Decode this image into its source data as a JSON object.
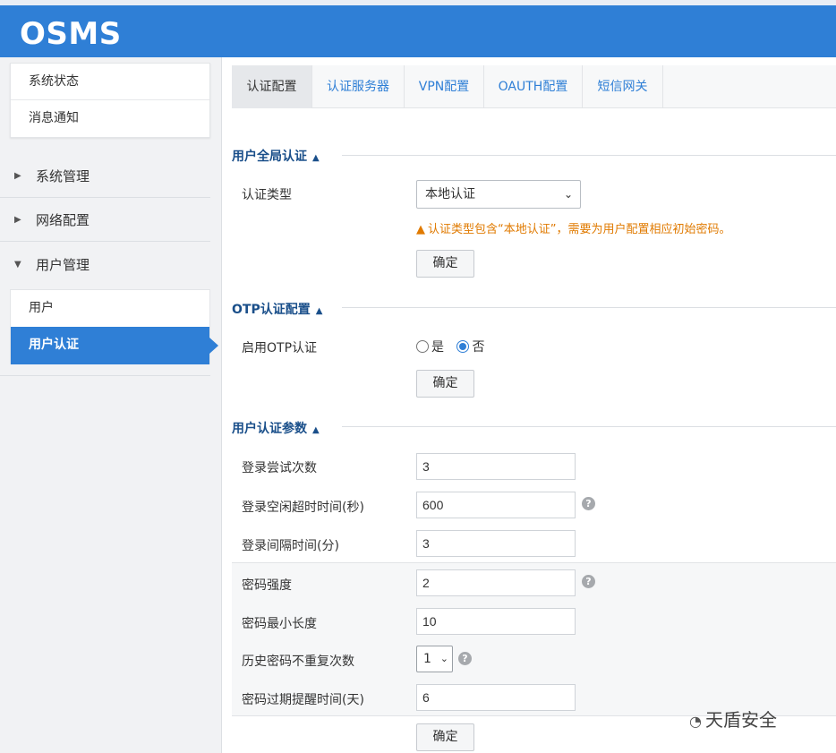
{
  "app": {
    "logo": "OSMS"
  },
  "sidebar": {
    "top_items": [
      "系统状态",
      "消息通知"
    ],
    "sections": [
      {
        "label": "系统管理",
        "state": "collapsed"
      },
      {
        "label": "网络配置",
        "state": "collapsed"
      },
      {
        "label": "用户管理",
        "state": "expanded"
      }
    ],
    "sub_items": [
      "用户",
      "用户认证"
    ],
    "active_sub": "用户认证"
  },
  "tabs": [
    "认证配置",
    "认证服务器",
    "VPN配置",
    "OAUTH配置",
    "短信网关"
  ],
  "active_tab": "认证配置",
  "global_auth": {
    "title": "用户全局认证",
    "type_label": "认证类型",
    "type_value": "本地认证",
    "warning": "认证类型包含“本地认证”，需要为用户配置相应初始密码。",
    "confirm": "确定"
  },
  "otp": {
    "title": "OTP认证配置",
    "enable_label": "启用OTP认证",
    "options": [
      "是",
      "否"
    ],
    "selected": "否",
    "confirm": "确定"
  },
  "params": {
    "title": "用户认证参数",
    "fields": [
      {
        "label": "登录尝试次数",
        "value": "3"
      },
      {
        "label": "登录空闲超时时间(秒)",
        "value": "600"
      },
      {
        "label": "登录间隔时间(分)",
        "value": "3"
      },
      {
        "label": "密码强度",
        "value": "2"
      },
      {
        "label": "密码最小长度",
        "value": "10"
      },
      {
        "label": "历史密码不重复次数",
        "value": "1"
      },
      {
        "label": "密码过期提醒时间(天)",
        "value": "6"
      }
    ],
    "confirm": "确定"
  },
  "watermark": "天盾安全",
  "colors": {
    "brand": "#2f7fd6",
    "warning": "#e07a00",
    "section_title": "#1a4f8a"
  },
  "icons": {
    "collapsed": "caret-right-icon",
    "expanded": "caret-down-icon",
    "help": "question-circle-icon",
    "warning": "warning-triangle-icon"
  }
}
